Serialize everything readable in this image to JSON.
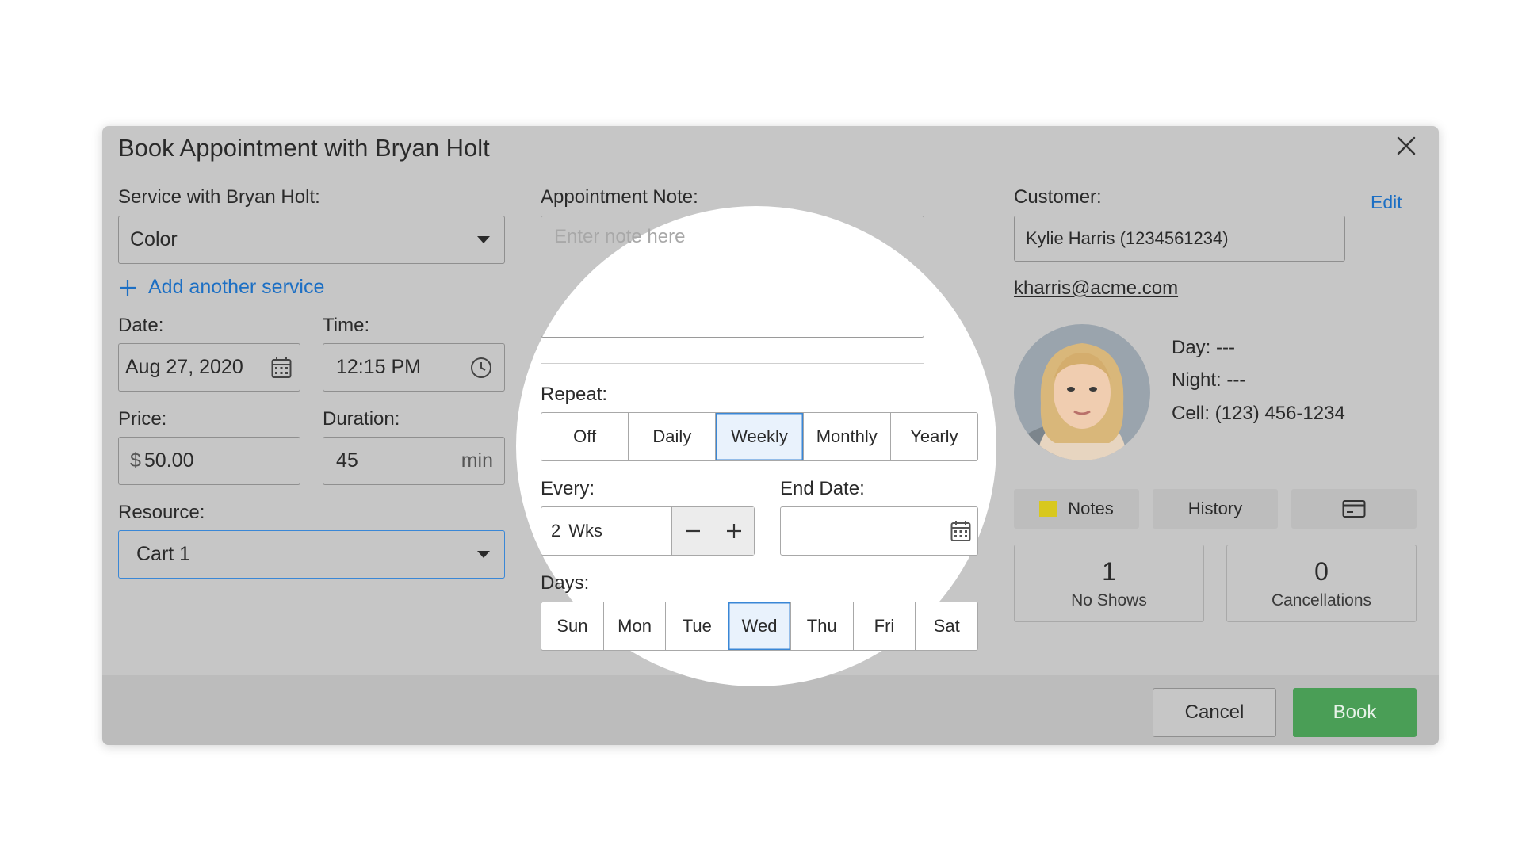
{
  "dialog": {
    "title": "Book Appointment with Bryan Holt"
  },
  "service": {
    "label": "Service with Bryan Holt:",
    "value": "Color",
    "add_link": "Add another service"
  },
  "date": {
    "label": "Date:",
    "value": "Aug 27, 2020"
  },
  "time": {
    "label": "Time:",
    "value": "12:15 PM"
  },
  "price": {
    "label": "Price:",
    "currency": "$",
    "value": "50.00"
  },
  "duration": {
    "label": "Duration:",
    "value": "45",
    "unit": "min"
  },
  "resource": {
    "label": "Resource:",
    "value": "Cart 1"
  },
  "note": {
    "label": "Appointment Note:",
    "placeholder": "Enter note here"
  },
  "repeat": {
    "label": "Repeat:",
    "options": [
      "Off",
      "Daily",
      "Weekly",
      "Monthly",
      "Yearly"
    ],
    "selected": "Weekly"
  },
  "every": {
    "label": "Every:",
    "value": "2",
    "unit": "Wks"
  },
  "end_date": {
    "label": "End Date:",
    "value": ""
  },
  "days": {
    "label": "Days:",
    "options": [
      "Sun",
      "Mon",
      "Tue",
      "Wed",
      "Thu",
      "Fri",
      "Sat"
    ],
    "selected": [
      "Wed"
    ]
  },
  "customer": {
    "label": "Customer:",
    "edit_link": "Edit",
    "name_value": "Kylie Harris (1234561234)",
    "email": "kharris@acme.com",
    "day": "Day: ---",
    "night": "Night: ---",
    "cell": "Cell: (123) 456-1234"
  },
  "tabs": {
    "notes": "Notes",
    "history": "History"
  },
  "stats": {
    "no_shows": {
      "count": "1",
      "label": "No Shows"
    },
    "cancellations": {
      "count": "0",
      "label": "Cancellations"
    }
  },
  "actions": {
    "cancel": "Cancel",
    "book": "Book"
  },
  "colors": {
    "overlay": "#c6c6c6",
    "link": "#1c6fc4",
    "book_button": "#4a9e56",
    "active_segment": "#3a87d6",
    "notes_swatch": "#d8c81e"
  },
  "icons": [
    "close-icon",
    "calendar-icon",
    "clock-icon",
    "plus-icon",
    "minus-icon",
    "chevron-down-icon",
    "card-icon",
    "sticky-note-icon"
  ]
}
